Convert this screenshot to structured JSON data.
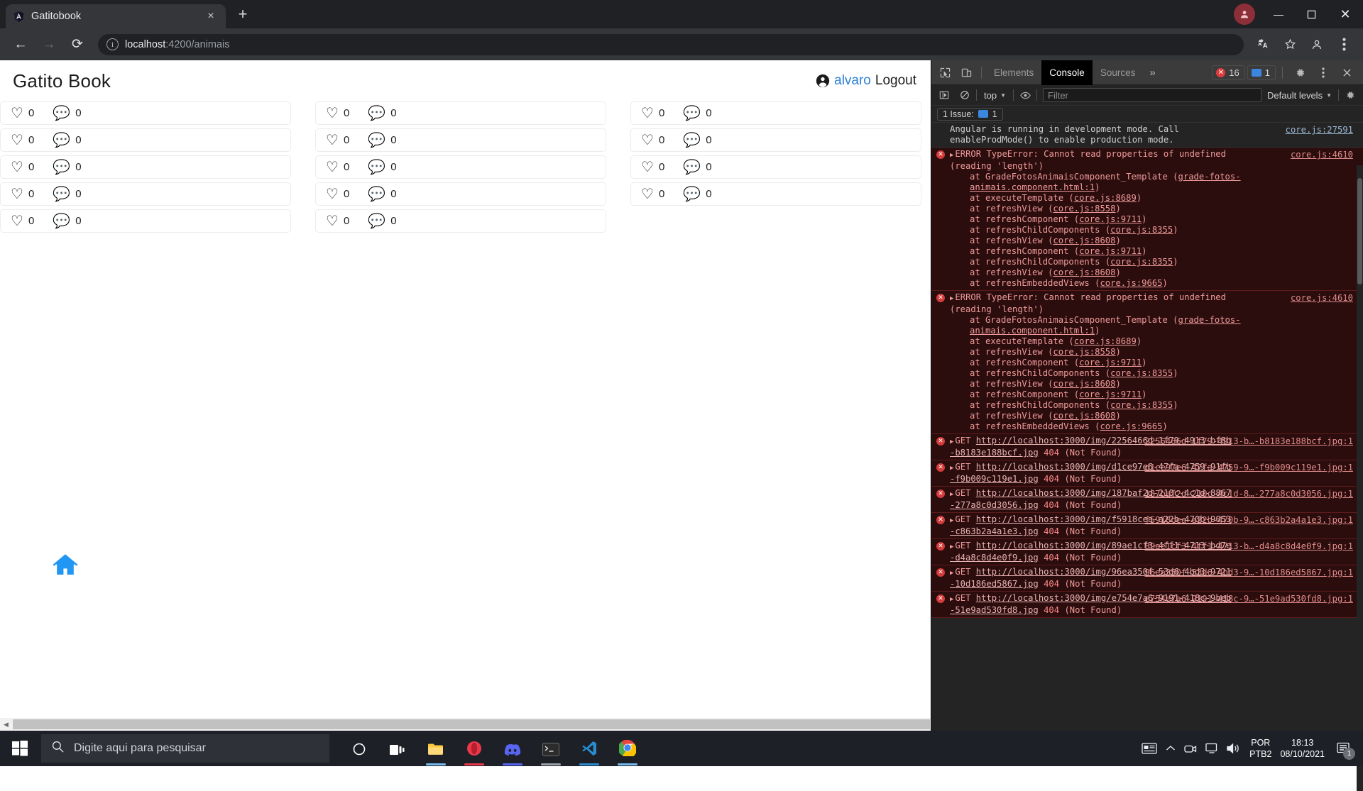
{
  "browser": {
    "tab": {
      "title": "Gatitobook",
      "favicon": "angular-logo-icon",
      "close": "×"
    },
    "new_tab_label": "+",
    "window_controls": {
      "minimize": "—",
      "maximize": "❐",
      "close": "✕"
    },
    "nav": {
      "back": "←",
      "forward": "→",
      "reload": "⟳"
    },
    "url": {
      "scheme_host": "localhost",
      "path": ":4200/animais",
      "full": "localhost:4200/animais"
    },
    "omni_icons": [
      "translate-icon",
      "bookmark-star-icon",
      "profile-icon",
      "chrome-menu-icon"
    ]
  },
  "app": {
    "title": "Gatito Book",
    "user": {
      "name": "alvaro",
      "logout_label": "Logout"
    },
    "home_button": "home-icon",
    "columns": [
      {
        "cards": [
          {
            "likes": "0",
            "comments": "0"
          },
          {
            "likes": "0",
            "comments": "0"
          },
          {
            "likes": "0",
            "comments": "0"
          },
          {
            "likes": "0",
            "comments": "0"
          },
          {
            "likes": "0",
            "comments": "0"
          }
        ]
      },
      {
        "cards": [
          {
            "likes": "0",
            "comments": "0"
          },
          {
            "likes": "0",
            "comments": "0"
          },
          {
            "likes": "0",
            "comments": "0"
          },
          {
            "likes": "0",
            "comments": "0"
          },
          {
            "likes": "0",
            "comments": "0"
          }
        ]
      },
      {
        "cards": [
          {
            "likes": "0",
            "comments": "0"
          },
          {
            "likes": "0",
            "comments": "0"
          },
          {
            "likes": "0",
            "comments": "0"
          },
          {
            "likes": "0",
            "comments": "0"
          }
        ]
      }
    ]
  },
  "devtools": {
    "tabs": [
      {
        "label": "Elements",
        "active": false
      },
      {
        "label": "Console",
        "active": true
      },
      {
        "label": "Sources",
        "active": false
      }
    ],
    "more_tabs": "»",
    "error_count": "16",
    "message_count": "1",
    "settings_icon": "gear-icon",
    "kebab_icon": "more-vertical-icon",
    "close_icon": "close-icon",
    "console_toolbar": {
      "sidebar_toggle": "console-sidebar-icon",
      "clear": "clear-console-icon",
      "context": "top",
      "eye": "live-expression-icon",
      "filter_placeholder": "Filter",
      "levels": "Default levels",
      "settings": "gear-icon"
    },
    "issues_bar": {
      "text": "1 Issue:",
      "count": "1"
    },
    "messages": [
      {
        "type": "info",
        "text": "Angular is running in development mode. Call enableProdMode() to enable production mode.",
        "source": "core.js:27591"
      },
      {
        "type": "error",
        "header": "ERROR TypeError: Cannot read properties of undefined (reading 'length')",
        "source": "core.js:4610",
        "stack": [
          {
            "fn": "at GradeFotosAnimaisComponent_Template",
            "loc": "grade-fotos-animais.component.html:1"
          },
          {
            "fn": "at executeTemplate",
            "loc": "core.js:8689"
          },
          {
            "fn": "at refreshView",
            "loc": "core.js:8558"
          },
          {
            "fn": "at refreshComponent",
            "loc": "core.js:9711"
          },
          {
            "fn": "at refreshChildComponents",
            "loc": "core.js:8355"
          },
          {
            "fn": "at refreshView",
            "loc": "core.js:8608"
          },
          {
            "fn": "at refreshComponent",
            "loc": "core.js:9711"
          },
          {
            "fn": "at refreshChildComponents",
            "loc": "core.js:8355"
          },
          {
            "fn": "at refreshView",
            "loc": "core.js:8608"
          },
          {
            "fn": "at refreshEmbeddedViews",
            "loc": "core.js:9665"
          }
        ]
      },
      {
        "type": "error",
        "header": "ERROR TypeError: Cannot read properties of undefined (reading 'length')",
        "source": "core.js:4610",
        "stack": [
          {
            "fn": "at GradeFotosAnimaisComponent_Template",
            "loc": "grade-fotos-animais.component.html:1"
          },
          {
            "fn": "at executeTemplate",
            "loc": "core.js:8689"
          },
          {
            "fn": "at refreshView",
            "loc": "core.js:8558"
          },
          {
            "fn": "at refreshComponent",
            "loc": "core.js:9711"
          },
          {
            "fn": "at refreshChildComponents",
            "loc": "core.js:8355"
          },
          {
            "fn": "at refreshView",
            "loc": "core.js:8608"
          },
          {
            "fn": "at refreshComponent",
            "loc": "core.js:9711"
          },
          {
            "fn": "at refreshChildComponents",
            "loc": "core.js:8355"
          },
          {
            "fn": "at refreshView",
            "loc": "core.js:8608"
          },
          {
            "fn": "at refreshEmbeddedViews",
            "loc": "core.js:9665"
          }
        ]
      }
    ],
    "network_errors": [
      {
        "method": "GET",
        "host": "http://localhost:30",
        "path": "00/img/2256466d-1f79-4913-bf8b-b8183e188bcf.jpg",
        "status": "404",
        "status_text": "(Not Found)",
        "right_link": "2256466d-1f79-4913-b…-b8183e188bcf.jpg:1"
      },
      {
        "method": "GET",
        "host": "http://localhost:30",
        "path": "00/img/d1ce97e6-47fa-4759-91fb-f9b009c119e1.jpg",
        "status": "404",
        "status_text": "(Not Found)",
        "right_link": "d1ce97e6-47fa-4759-9…-f9b009c119e1.jpg:1"
      },
      {
        "method": "GET",
        "host": "http://localhost:30",
        "path": "00/img/187baf2d-210c-4c1d-8867-277a8c0d3056.jpg",
        "status": "404",
        "status_text": "(Not Found)",
        "right_link": "187baf2d-210c-4c1d-8…-277a8c0d3056.jpg:1"
      },
      {
        "method": "GET",
        "host": "http://localhost:30",
        "path": "00/img/f5918cea-a22b-470b-9053-c863b2a4a1e3.jpg",
        "status": "404",
        "status_text": "(Not Found)",
        "right_link": "f5918cea-a22b-470b-9…-c863b2a4a1e3.jpg:1"
      },
      {
        "method": "GET",
        "host": "http://localhost:30",
        "path": "00/img/89ae1cf3-4ff1-4713-bd7e-d4a8c8d4e0f9.jpg",
        "status": "404",
        "status_text": "(Not Found)",
        "right_link": "89ae1cf3-4ff1-4713-b…-d4a8c8d4e0f9.jpg:1"
      },
      {
        "method": "GET",
        "host": "http://localhost:30",
        "path": "00/img/96ea350f-53d6-4bd3-9721-10d186ed5867.jpg",
        "status": "404",
        "status_text": "(Not Found)",
        "right_link": "96ea350f-53d6-4bd3-9…-10d186ed5867.jpg:1"
      },
      {
        "method": "GET",
        "host": "http://localhost:30",
        "path": "00/img/e754e7a6-9191-418c-9beb-51e9ad530fd8.jpg",
        "status": "404",
        "status_text": "(Not Found)",
        "right_link": "e754e7a6-9191-418c-9…-51e9ad530fd8.jpg:1"
      }
    ]
  },
  "taskbar": {
    "start": "windows-start-icon",
    "search_placeholder": "Digite aqui para pesquisar",
    "apps": [
      {
        "name": "cortana-icon",
        "color": "#ffffff"
      },
      {
        "name": "task-view-icon",
        "color": "#ffffff"
      },
      {
        "name": "file-explorer-icon",
        "color": "#ffc83d"
      },
      {
        "name": "opera-icon",
        "color": "#e8394a"
      },
      {
        "name": "discord-icon",
        "color": "#5865f2"
      },
      {
        "name": "terminal-icon",
        "color": "#3a3a3a"
      },
      {
        "name": "vscode-icon",
        "color": "#2a8bd0"
      },
      {
        "name": "chrome-icon",
        "color": "#4285f4"
      }
    ],
    "tray": {
      "news_icon": "news-weather-icon",
      "overflow_icon": "chevron-up-icon",
      "camera_icon": "camera-icon",
      "display_icon": "display-icon",
      "volume_icon": "volume-icon",
      "language": "POR",
      "keyboard": "PTB2",
      "time": "18:13",
      "date": "08/10/2021",
      "notification_count": "1"
    }
  }
}
